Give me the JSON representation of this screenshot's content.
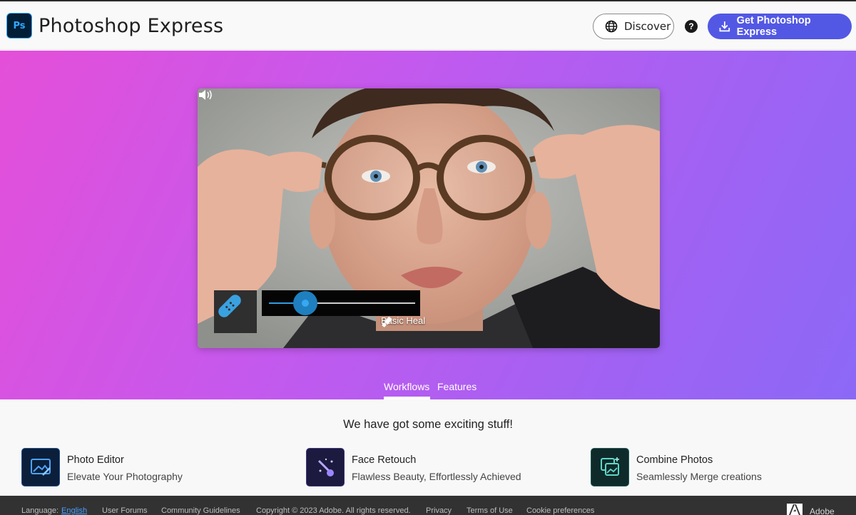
{
  "header": {
    "logo_text": "Ps",
    "brand": "Photoshop Express",
    "discover_label": "Discover",
    "help_label": "?",
    "get_label": "Get Photoshop Express"
  },
  "hero": {
    "tool_label": "Basic Heal",
    "slider_value": 0.25,
    "tabs": [
      {
        "label": "Workflows",
        "active": true
      },
      {
        "label": "Features",
        "active": false
      }
    ]
  },
  "main": {
    "headline": "We have got some exciting stuff!",
    "features": [
      {
        "title": "Photo Editor",
        "subtitle": "Elevate Your Photography",
        "icon": "photo-editor-icon"
      },
      {
        "title": "Face Retouch",
        "subtitle": "Flawless Beauty, Effortlessly Achieved",
        "icon": "face-retouch-icon"
      },
      {
        "title": "Combine Photos",
        "subtitle": "Seamlessly Merge creations",
        "icon": "combine-photos-icon"
      }
    ]
  },
  "footer": {
    "language_label": "Language:",
    "language_value": "English",
    "links": [
      "User Forums",
      "Community Guidelines",
      "Copyright © 2023 Adobe. All rights reserved.",
      "Privacy",
      "Terms of Use",
      "Cookie preferences"
    ],
    "adobe": "Adobe"
  },
  "colors": {
    "accent": "#5258e4",
    "hero_start": "#e44fd8",
    "hero_end": "#8c68f6",
    "footer_bg": "#323232"
  }
}
